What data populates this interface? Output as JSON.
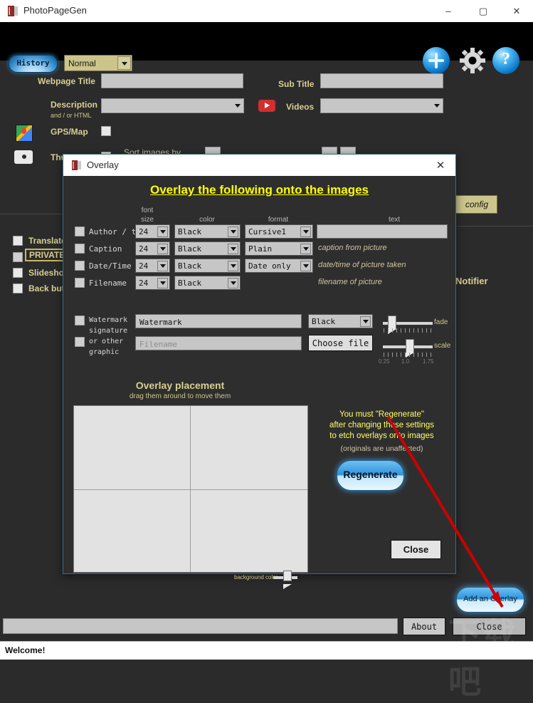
{
  "window": {
    "title": "PhotoPageGen",
    "minimize": "–",
    "maximize": "▢",
    "close": "✕",
    "icon": "app-book-icon"
  },
  "toolbar": {
    "history_label": "History",
    "mode_value": "Normal",
    "add_icon": "plus-circle-icon",
    "settings_icon": "gear-icon",
    "help_icon": "question-circle-icon"
  },
  "form": {
    "webpage_title_label": "Webpage Title",
    "webpage_title_value": "",
    "sub_title_label": "Sub Title",
    "sub_title_value": "",
    "description_label": "Description",
    "description_sub_label": "and / or HTML",
    "description_value": "",
    "videos_label": "Videos",
    "videos_value": "",
    "videos_icon": "youtube-icon",
    "gps_map_label": "GPS/Map",
    "gps_map_icon": "google-maps-icon",
    "thumbnails_label": "Thu",
    "thumbnails_icon": "camera-icon",
    "sort_images_by_label": "Sort images by",
    "config_label": "config",
    "notifier_label": "Notifier",
    "checkboxes": [
      {
        "label": "Translate",
        "checked": false
      },
      {
        "label": "PRIVATE",
        "checked": false
      },
      {
        "label": "Slideshow",
        "checked": false
      },
      {
        "label": "Back button",
        "checked": false
      }
    ]
  },
  "overlay_dialog": {
    "titlebar": "Overlay",
    "close_glyph": "✕",
    "heading": "Overlay the following onto the images",
    "column_headers": {
      "font": "font",
      "size": "size",
      "color": "color",
      "format": "format",
      "text": "text"
    },
    "rows": [
      {
        "label": "Author / text",
        "checked": false,
        "size": "24",
        "color": "Black",
        "format": "Cursive1",
        "text_value": "",
        "hint": ""
      },
      {
        "label": "Caption",
        "checked": false,
        "size": "24",
        "color": "Black",
        "format": "Plain",
        "text_value": "",
        "hint": "caption from picture"
      },
      {
        "label": "Date/Time",
        "checked": false,
        "size": "24",
        "color": "Black",
        "format": "Date only",
        "text_value": "",
        "hint": "date/time of picture taken"
      },
      {
        "label": "Filename",
        "checked": false,
        "size": "24",
        "color": "Black",
        "format": "",
        "text_value": "",
        "hint": "filename of picture"
      }
    ],
    "watermark": {
      "label_line1": "Watermark",
      "label_line2": "signature",
      "label_line3": "or other",
      "label_line4": "graphic",
      "text_value": "Watermark",
      "color": "Black",
      "file_placeholder": "Filename",
      "choose_file_label": "Choose file",
      "fade_label": "fade",
      "scale_label": "scale",
      "scale_min": "0.25",
      "scale_mid": "1.0",
      "scale_max": "1.75"
    },
    "placement": {
      "title": "Overlay placement",
      "subtitle": "drag them around to move them",
      "background_color_label": "background color"
    },
    "warning_line1": "You must \"Regenerate\"",
    "warning_line2": "after changing these settings",
    "warning_line3": "to etch overlays onto images",
    "warning_note": "(originals are unaffected)",
    "regenerate_label": "Regenerate",
    "close_label": "Close"
  },
  "bottom": {
    "add_overlay_label": "Add an Overlay",
    "about_label": "About",
    "close_label": "Close",
    "status_text": "Welcome!"
  },
  "watermark_overlay": {
    "text": "下载吧",
    "url": "www.downla.net"
  },
  "colors": {
    "accent_gold": "#d8cf93",
    "heading_yellow": "#ffff00",
    "dark_bg": "#2b2b2b",
    "modal_bg": "#2e2e2e",
    "button_blue": "#2f93dc",
    "annotation_red": "#cc0000"
  }
}
